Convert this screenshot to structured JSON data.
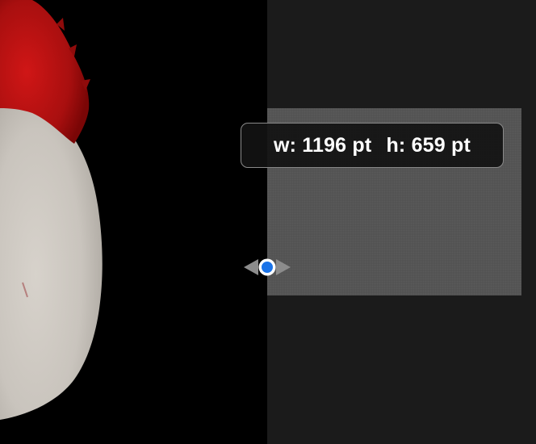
{
  "tooltip": {
    "width_text": "w: 1196 pt",
    "height_text": "h: 659 pt"
  },
  "colors": {
    "background_left": "#000000",
    "background_right": "#1b1b1b",
    "selection_fill": "#767676",
    "tooltip_background": "#121212",
    "tooltip_border": "#8a8a8a",
    "handle_dot": "#1a73e8",
    "handle_arrows": "#8c8c8c",
    "hair_red": "#b81010",
    "egg_face": "#ccc7c0"
  },
  "icons": {
    "resize_handle": "horizontal-resize-handle-icon"
  }
}
